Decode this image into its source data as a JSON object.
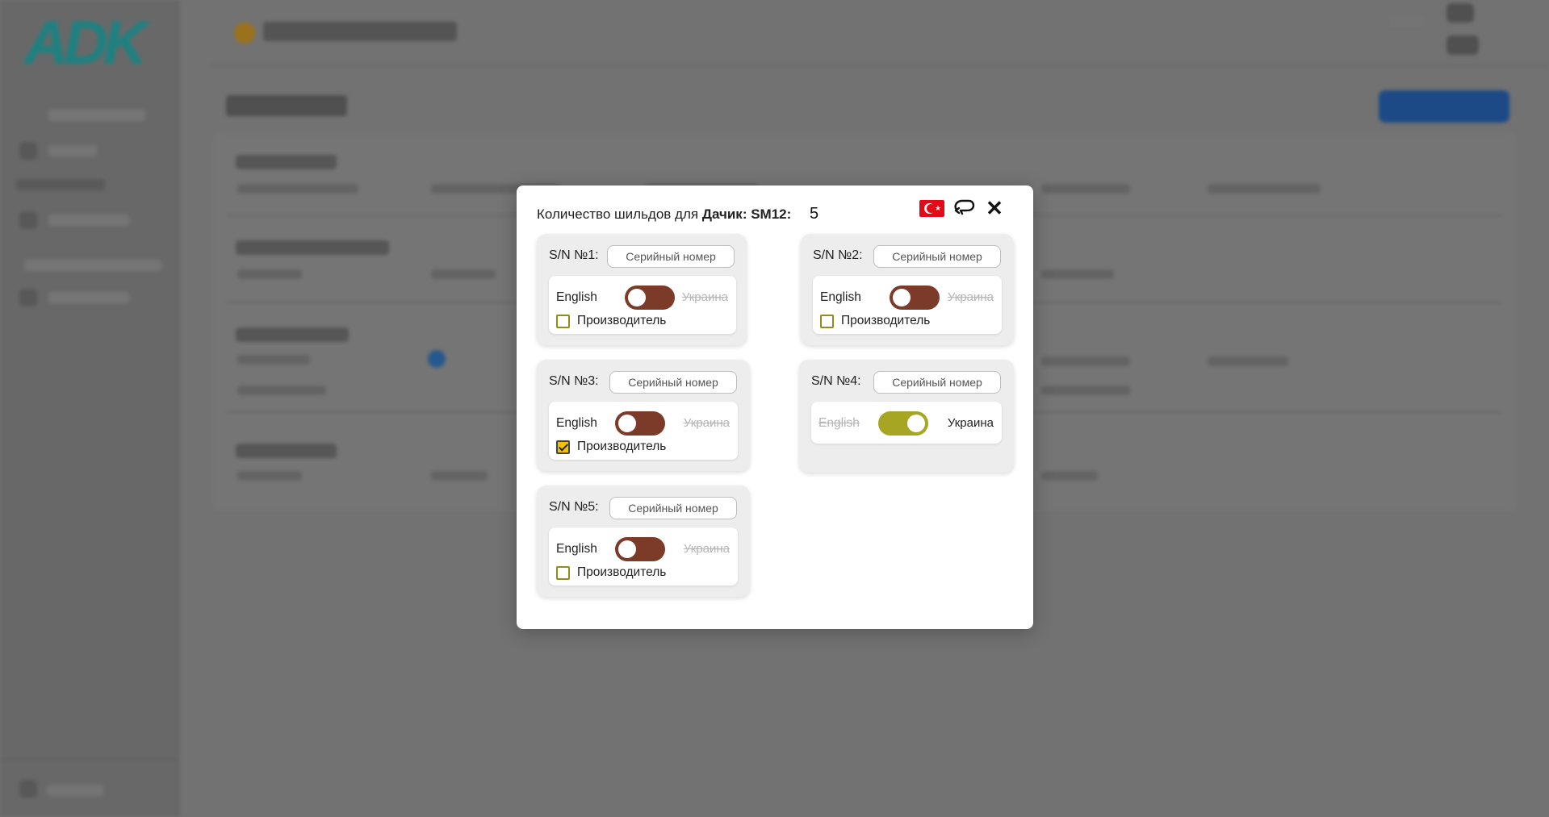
{
  "background": {
    "brand_logo": "ADK"
  },
  "modal": {
    "title_prefix": "Количество шильдов для",
    "title_entity": "Дачик: SM12:",
    "count": "5",
    "icons": {
      "flag": "turkey-flag-icon",
      "repeat": "repeat-icon",
      "close": "close-icon"
    },
    "cards": [
      {
        "label": "S/N №1:",
        "serial_placeholder": "Серийный номер",
        "lang_left": "English",
        "lang_right": "Украина",
        "toggle_on": false,
        "show_manufacturer": true,
        "manufacturer_label": "Производитель",
        "manufacturer_checked": false
      },
      {
        "label": "S/N №2:",
        "serial_placeholder": "Серийный номер",
        "lang_left": "English",
        "lang_right": "Украина",
        "toggle_on": false,
        "show_manufacturer": true,
        "manufacturer_label": "Производитель",
        "manufacturer_checked": false
      },
      {
        "label": "S/N №3:",
        "serial_placeholder": "Серийный номер",
        "lang_left": "English",
        "lang_right": "Украина",
        "toggle_on": false,
        "show_manufacturer": true,
        "manufacturer_label": "Производитель",
        "manufacturer_checked": true
      },
      {
        "label": "S/N №4:",
        "serial_placeholder": "Серийный номер",
        "lang_left": "English",
        "lang_right": "Украина",
        "toggle_on": true,
        "show_manufacturer": false
      },
      {
        "label": "S/N №5:",
        "serial_placeholder": "Серийный номер",
        "lang_left": "English",
        "lang_right": "Украина",
        "toggle_on": false,
        "show_manufacturer": true,
        "manufacturer_label": "Производитель",
        "manufacturer_checked": false
      }
    ]
  },
  "colors": {
    "toggle_off": "#7b3b28",
    "toggle_on": "#a6a622",
    "checkbox_border": "#8f8f13",
    "checkbox_checked": "#f2c200",
    "overlay": "#7a7a7a"
  }
}
